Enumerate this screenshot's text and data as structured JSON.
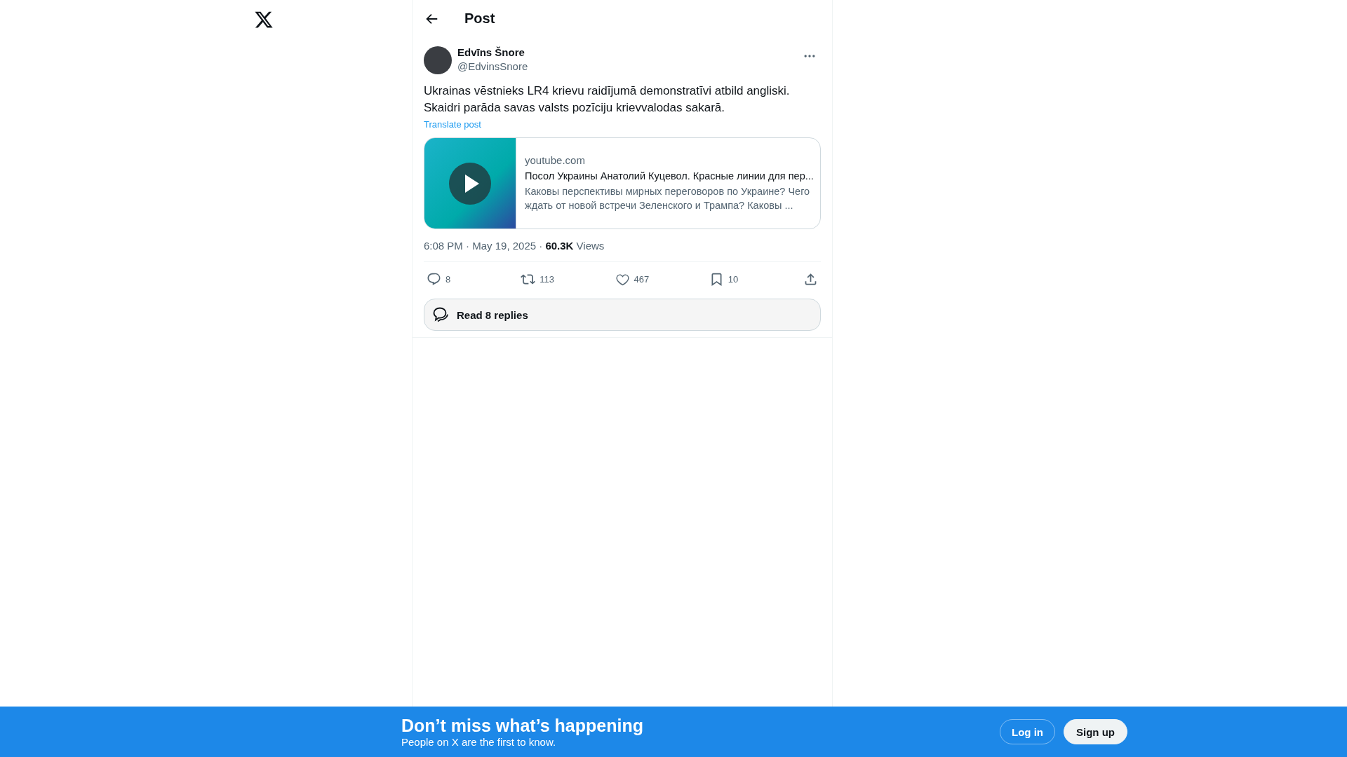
{
  "header": {
    "title": "Post"
  },
  "post": {
    "author": {
      "name": "Edvīns Šnore",
      "handle": "@EdvinsSnore"
    },
    "text": "Ukrainas vēstnieks LR4 krievu raidījumā demonstratīvi atbild angliski. Skaidri parāda savas valsts pozīciju krievvalodas sakarā.",
    "translate": "Translate post",
    "link_card": {
      "domain": "youtube.com",
      "title": "Посол Украины Анатолий Куцевол. Красные линии для пер...",
      "description": "Каковы перспективы мирных переговоров по Украине? Чего ждать от новой встречи Зеленского и Трампа? Каковы ..."
    },
    "meta": "6:08 PM · May 19, 2025 · **60.3K** Views",
    "actions": [
      {
        "kind": "reply",
        "count": "8"
      },
      {
        "kind": "repost",
        "count": "113"
      },
      {
        "kind": "like",
        "count": "467"
      },
      {
        "kind": "bookmark",
        "count": "10"
      },
      {
        "kind": "share"
      }
    ],
    "read_replies": "Read 8 replies"
  },
  "banner": {
    "title": "Don’t miss what’s happening",
    "subtitle": "People on X are the first to know.",
    "buttons": [
      {
        "kind": "outline",
        "label": "Log in"
      },
      {
        "kind": "filled",
        "label": "Sign up"
      }
    ]
  }
}
